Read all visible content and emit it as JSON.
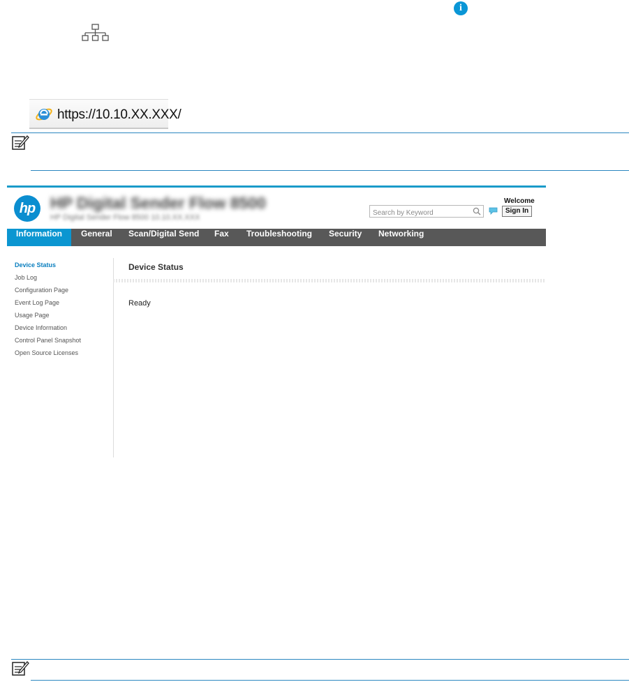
{
  "icons": {
    "info": "info-icon",
    "network": "network-icon",
    "browser": "internet-explorer-icon",
    "note": "note-icon",
    "search": "search-icon",
    "feedback": "feedback-icon",
    "logo": "hp-logo"
  },
  "address_bar": {
    "url": "https://10.10.XX.XXX/"
  },
  "ews": {
    "logo_text": "hp",
    "device_title": "HP Digital Sender Flow 8500",
    "device_subtitle": "HP Digital Sender Flow 8500      10.10.XX.XXX",
    "search": {
      "placeholder": "Search by Keyword"
    },
    "welcome": "Welcome",
    "sign_in": "Sign In",
    "tabs": [
      {
        "label": "Information",
        "active": true
      },
      {
        "label": "General"
      },
      {
        "label": "Scan/Digital Send"
      },
      {
        "label": "Fax"
      },
      {
        "label": "Troubleshooting"
      },
      {
        "label": "Security"
      },
      {
        "label": "Networking"
      }
    ],
    "sidebar": [
      {
        "label": "Device Status",
        "active": true
      },
      {
        "label": "Job Log"
      },
      {
        "label": "Configuration Page"
      },
      {
        "label": "Event Log Page"
      },
      {
        "label": "Usage Page"
      },
      {
        "label": "Device Information"
      },
      {
        "label": "Control Panel Snapshot"
      },
      {
        "label": "Open Source Licenses"
      }
    ],
    "content": {
      "title": "Device Status",
      "status": "Ready"
    }
  },
  "colors": {
    "accent": "#0b96d1",
    "navbar": "#585858",
    "rule": "#2a86c0"
  }
}
